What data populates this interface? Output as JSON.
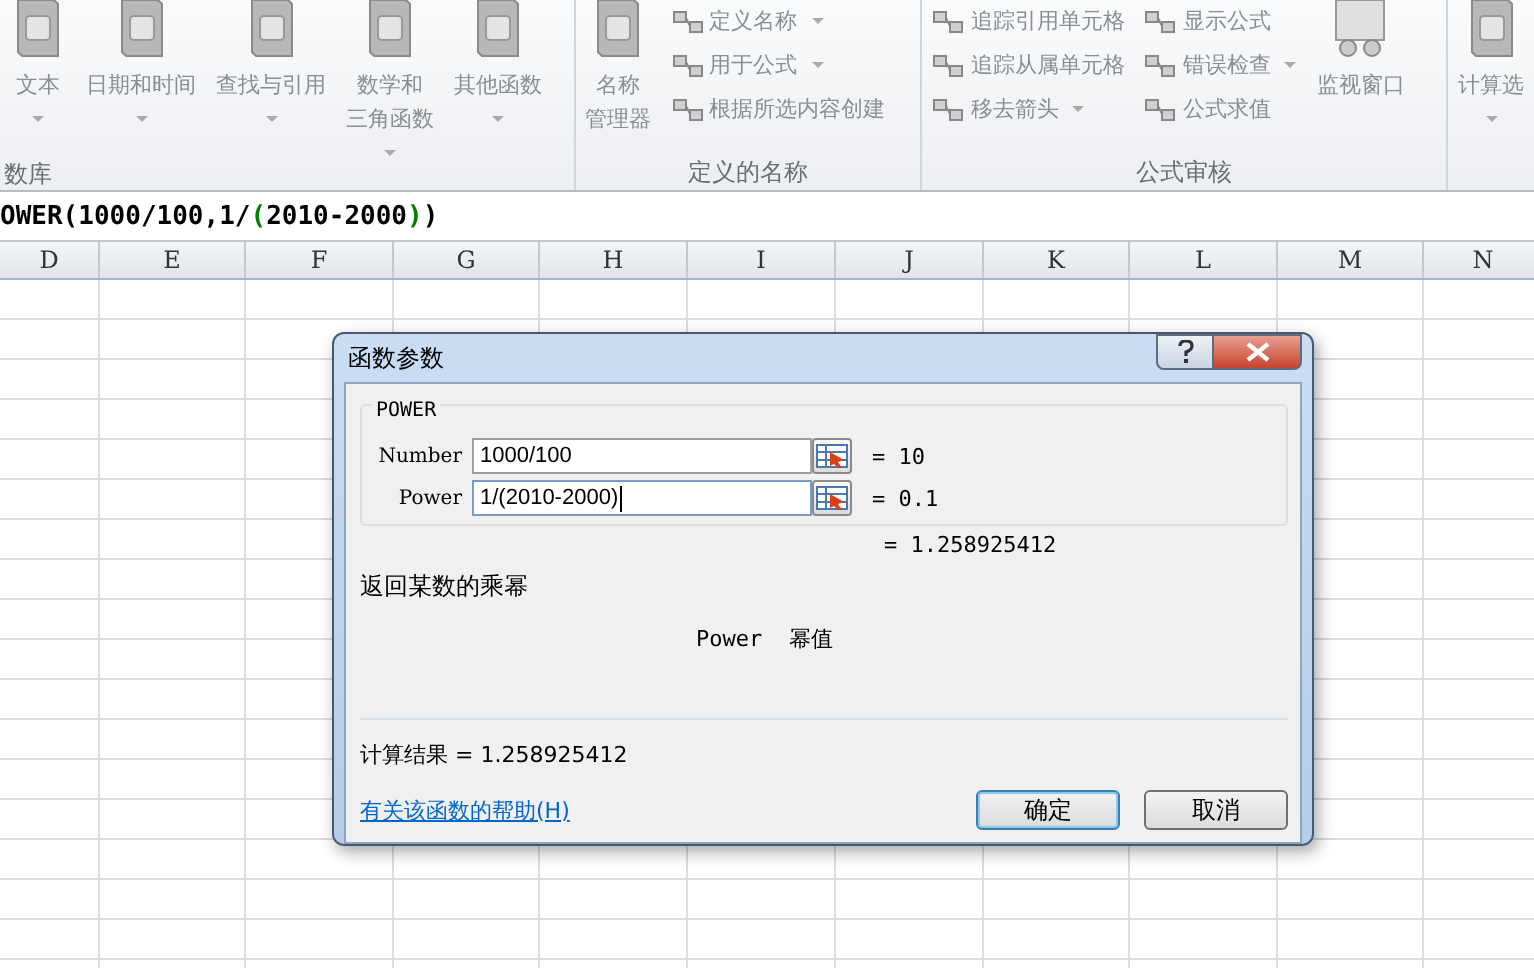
{
  "ribbon": {
    "groups": [
      {
        "label": "数库",
        "big_buttons": [
          {
            "lines": [
              "文本"
            ],
            "dropdown": true
          },
          {
            "lines": [
              "日期和时间"
            ],
            "dropdown": true
          },
          {
            "lines": [
              "查找与引用"
            ],
            "dropdown": true
          },
          {
            "lines": [
              "数学和",
              "三角函数"
            ],
            "dropdown": true
          },
          {
            "lines": [
              "其他函数"
            ],
            "dropdown": true
          }
        ]
      },
      {
        "label": "定义的名称",
        "big_buttons": [
          {
            "lines": [
              "名称",
              "管理器"
            ],
            "dropdown": false
          }
        ],
        "columns": [
          [
            {
              "label": "定义名称",
              "dropdown": true
            },
            {
              "label": "用于公式",
              "dropdown": true
            },
            {
              "label": "根据所选内容创建",
              "dropdown": false
            }
          ]
        ]
      },
      {
        "label": "公式审核",
        "columns": [
          [
            {
              "label": "追踪引用单元格",
              "dropdown": false
            },
            {
              "label": "追踪从属单元格",
              "dropdown": false
            },
            {
              "label": "移去箭头",
              "dropdown": true
            }
          ],
          [
            {
              "label": "显示公式",
              "dropdown": false
            },
            {
              "label": "错误检查",
              "dropdown": true
            },
            {
              "label": "公式求值",
              "dropdown": false
            }
          ]
        ],
        "trailing_buttons": [
          {
            "lines": [
              "监视窗口"
            ],
            "dropdown": false
          }
        ]
      },
      {
        "big_buttons": [
          {
            "lines": [
              "计算选"
            ],
            "dropdown": true
          }
        ]
      }
    ]
  },
  "formula_bar": [
    {
      "text": "OWER(1000/100,1/",
      "color": "#000000"
    },
    {
      "text": "(",
      "color": "#008000"
    },
    {
      "text": "2010-2000",
      "color": "#000000"
    },
    {
      "text": ")",
      "color": "#008000"
    },
    {
      "text": ")",
      "color": "#000000"
    }
  ],
  "sheet": {
    "columns": [
      "D",
      "E",
      "F",
      "G",
      "H",
      "I",
      "J",
      "K",
      "L",
      "M",
      "N"
    ]
  },
  "dialog": {
    "title": "函数参数",
    "function_name": "POWER",
    "arguments": [
      {
        "label": "Number",
        "value": "1000/100",
        "result": "= 10",
        "focused": false
      },
      {
        "label": "Power",
        "value": "1/(2010-2000)",
        "result": "= 0.1",
        "focused": true
      }
    ],
    "formula_result": "= 1.258925412",
    "description": "返回某数的乘幂",
    "argument_help": "Power  幂值",
    "calculation_result": "计算结果 = 1.258925412",
    "help_link": "有关该函数的帮助(H)",
    "buttons": [
      {
        "label": "确定",
        "default": true
      },
      {
        "label": "取消",
        "default": false
      }
    ]
  }
}
